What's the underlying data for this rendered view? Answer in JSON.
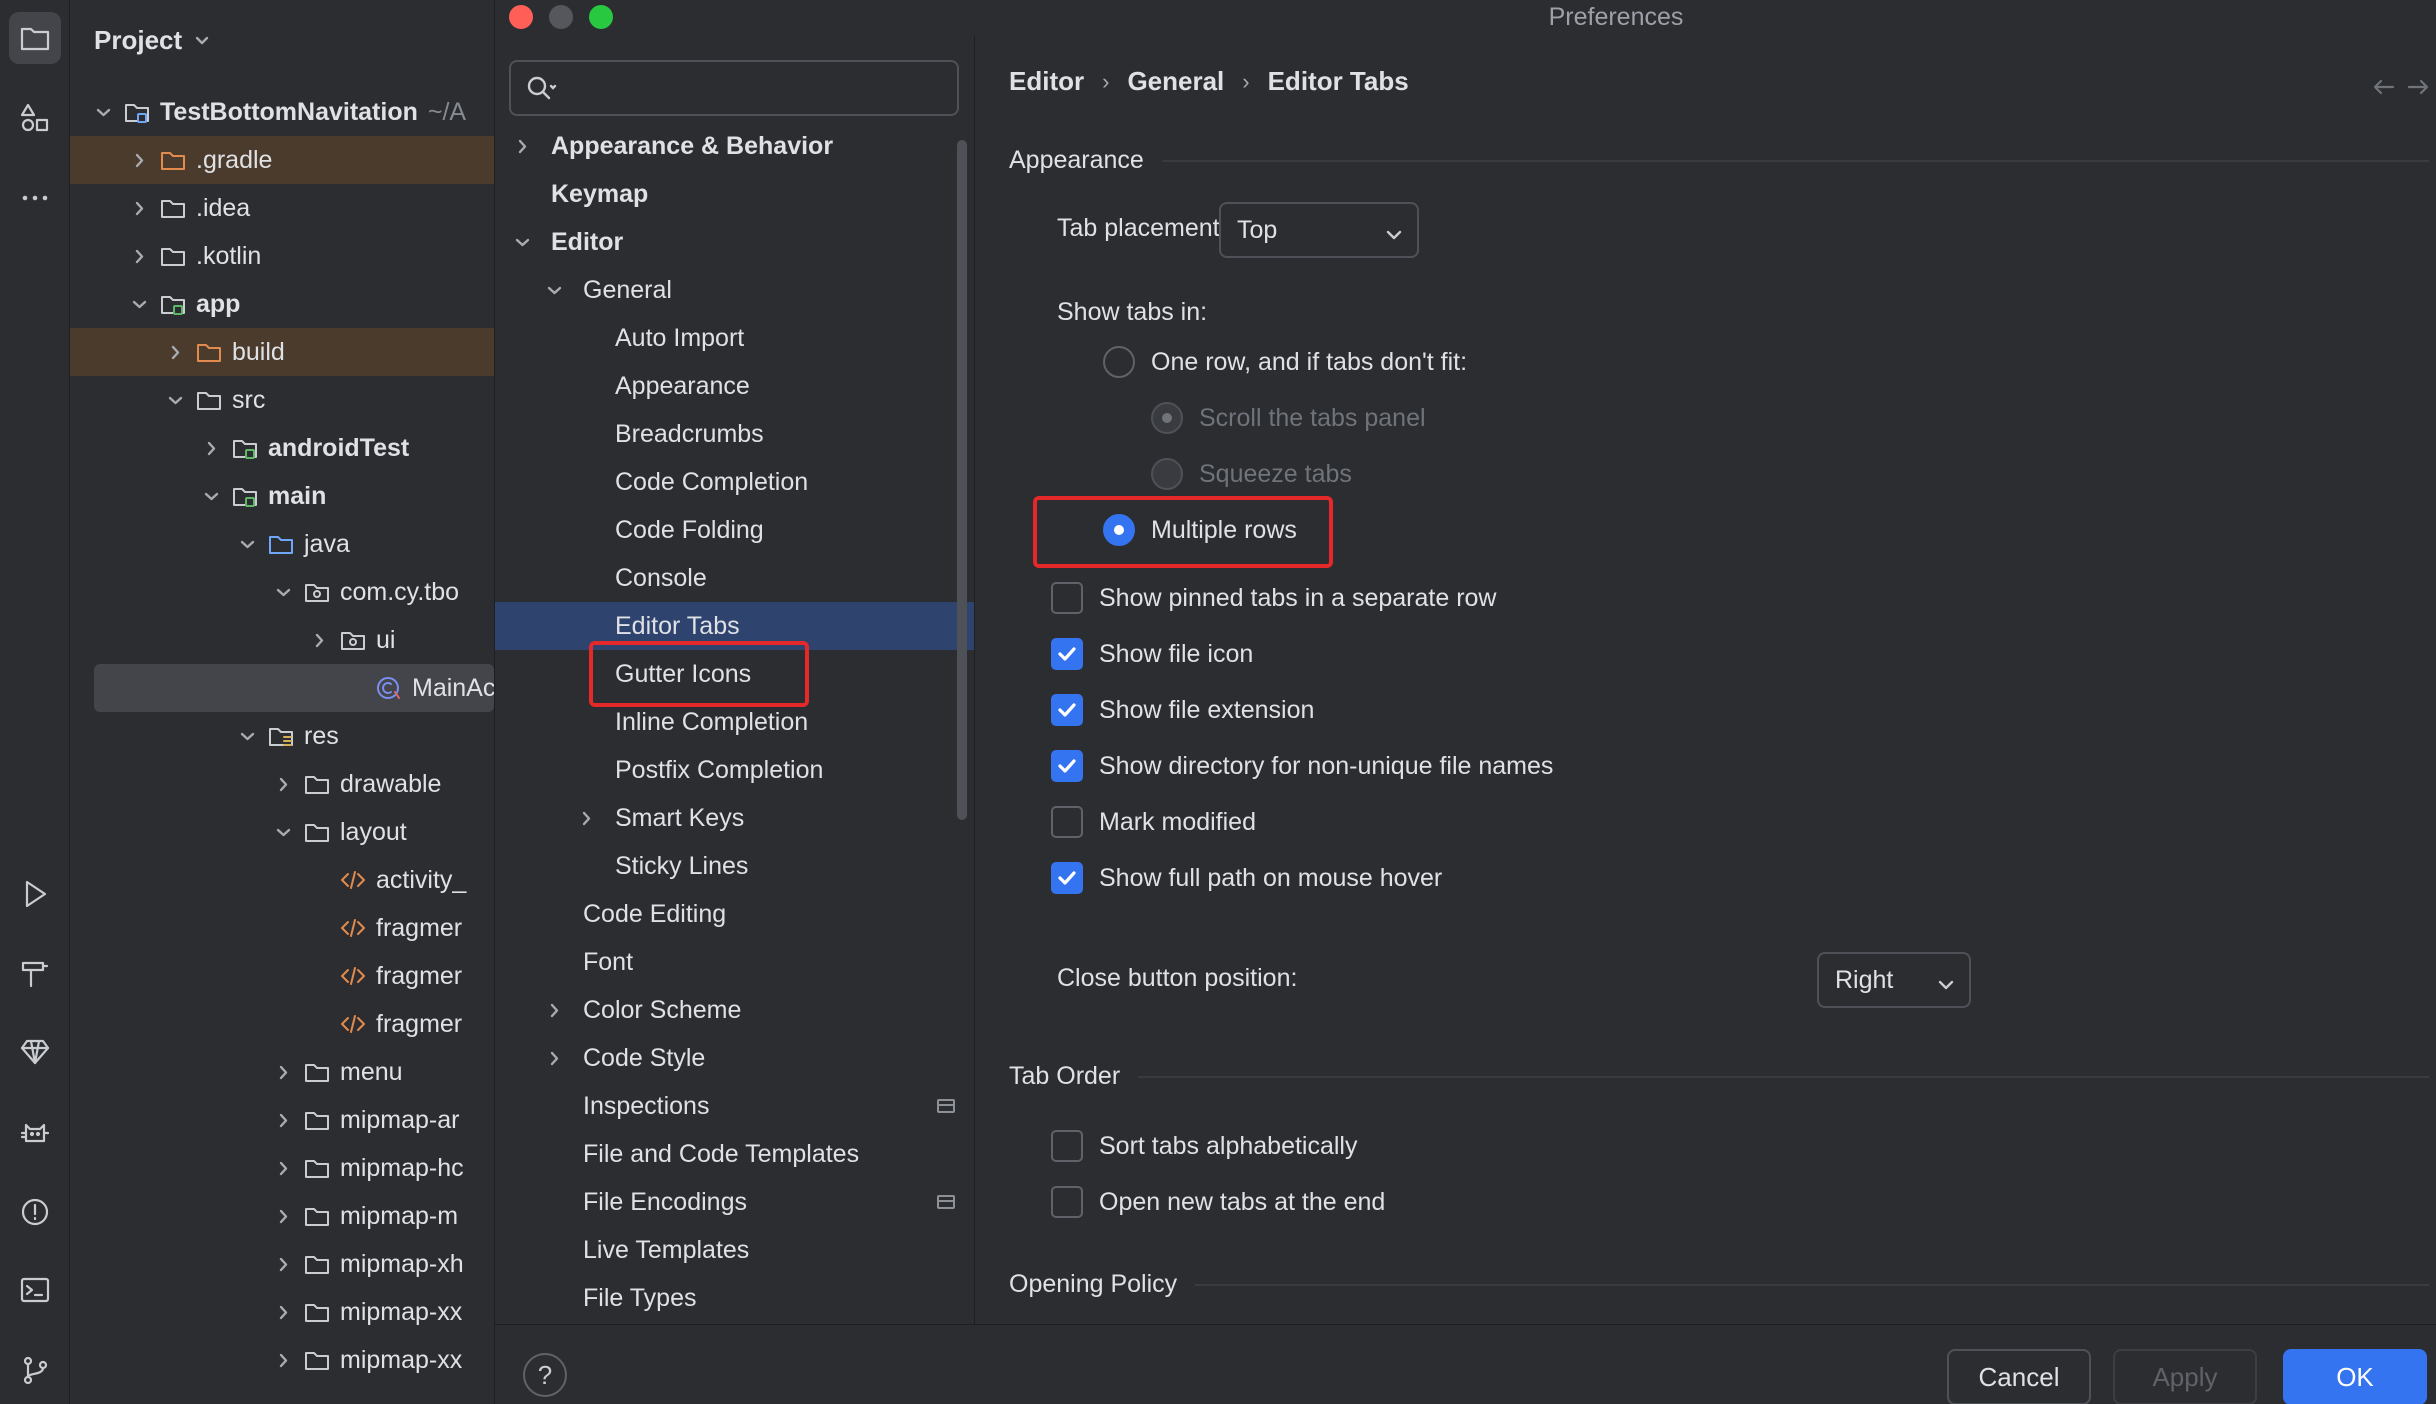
{
  "colors": {
    "accent": "#3574f0",
    "highlight": "#e5292b",
    "selection": "#2e436e",
    "background": "#2b2d30"
  },
  "stripe": {
    "icons": [
      "folder-icon",
      "structure-icon",
      "more-icon",
      "run-icon",
      "build-icon",
      "gem-icon",
      "cat-icon",
      "problems-icon",
      "terminal-icon",
      "vcs-icon"
    ]
  },
  "project": {
    "title": "Project",
    "tree": [
      {
        "label": "TestBottomNavitation",
        "suffix": "~/A",
        "bold": true
      },
      {
        "label": ".gradle"
      },
      {
        "label": ".idea"
      },
      {
        "label": ".kotlin"
      },
      {
        "label": "app",
        "bold": true
      },
      {
        "label": "build"
      },
      {
        "label": "src"
      },
      {
        "label": "androidTest",
        "bold": true
      },
      {
        "label": "main",
        "bold": true
      },
      {
        "label": "java"
      },
      {
        "label": "com.cy.tbo"
      },
      {
        "label": "ui"
      },
      {
        "label": "MainAc"
      },
      {
        "label": "res"
      },
      {
        "label": "drawable"
      },
      {
        "label": "layout"
      },
      {
        "label": "activity_"
      },
      {
        "label": "fragmer"
      },
      {
        "label": "fragmer"
      },
      {
        "label": "fragmer"
      },
      {
        "label": "menu"
      },
      {
        "label": "mipmap-ar"
      },
      {
        "label": "mipmap-hc"
      },
      {
        "label": "mipmap-m"
      },
      {
        "label": "mipmap-xh"
      },
      {
        "label": "mipmap-xx"
      },
      {
        "label": "mipmap-xx"
      }
    ]
  },
  "dialog": {
    "title": "Preferences",
    "search": {
      "placeholder": ""
    },
    "nav": [
      {
        "label": "Appearance & Behavior"
      },
      {
        "label": "Keymap"
      },
      {
        "label": "Editor"
      },
      {
        "label": "General"
      },
      {
        "label": "Auto Import"
      },
      {
        "label": "Appearance"
      },
      {
        "label": "Breadcrumbs"
      },
      {
        "label": "Code Completion"
      },
      {
        "label": "Code Folding"
      },
      {
        "label": "Console"
      },
      {
        "label": "Editor Tabs"
      },
      {
        "label": "Gutter Icons"
      },
      {
        "label": "Inline Completion"
      },
      {
        "label": "Postfix Completion"
      },
      {
        "label": "Smart Keys"
      },
      {
        "label": "Sticky Lines"
      },
      {
        "label": "Code Editing"
      },
      {
        "label": "Font"
      },
      {
        "label": "Color Scheme"
      },
      {
        "label": "Code Style"
      },
      {
        "label": "Inspections"
      },
      {
        "label": "File and Code Templates"
      },
      {
        "label": "File Encodings"
      },
      {
        "label": "Live Templates"
      },
      {
        "label": "File Types"
      }
    ],
    "breadcrumb": [
      "Editor",
      "General",
      "Editor Tabs"
    ],
    "sections": {
      "appearance": "Appearance",
      "tab_order": "Tab Order",
      "opening_policy": "Opening Policy"
    },
    "tab_placement": {
      "label": "Tab placement:",
      "value": "Top"
    },
    "show_tabs_in": {
      "label": "Show tabs in:",
      "one_row": "One row, and if tabs don't fit:",
      "scroll": "Scroll the tabs panel",
      "squeeze": "Squeeze tabs",
      "multiple": "Multiple rows",
      "selected": "multiple"
    },
    "checks": [
      {
        "label": "Show pinned tabs in a separate row",
        "checked": false
      },
      {
        "label": "Show file icon",
        "checked": true
      },
      {
        "label": "Show file extension",
        "checked": true
      },
      {
        "label": "Show directory for non-unique file names",
        "checked": true
      },
      {
        "label": "Mark modified",
        "checked": false
      },
      {
        "label": "Show full path on mouse hover",
        "checked": true
      }
    ],
    "close_button": {
      "label": "Close button position:",
      "value": "Right"
    },
    "order_checks": [
      {
        "label": "Sort tabs alphabetically",
        "checked": false
      },
      {
        "label": "Open new tabs at the end",
        "checked": false
      }
    ],
    "footer": {
      "help": "?",
      "cancel": "Cancel",
      "apply": "Apply",
      "ok": "OK"
    }
  }
}
